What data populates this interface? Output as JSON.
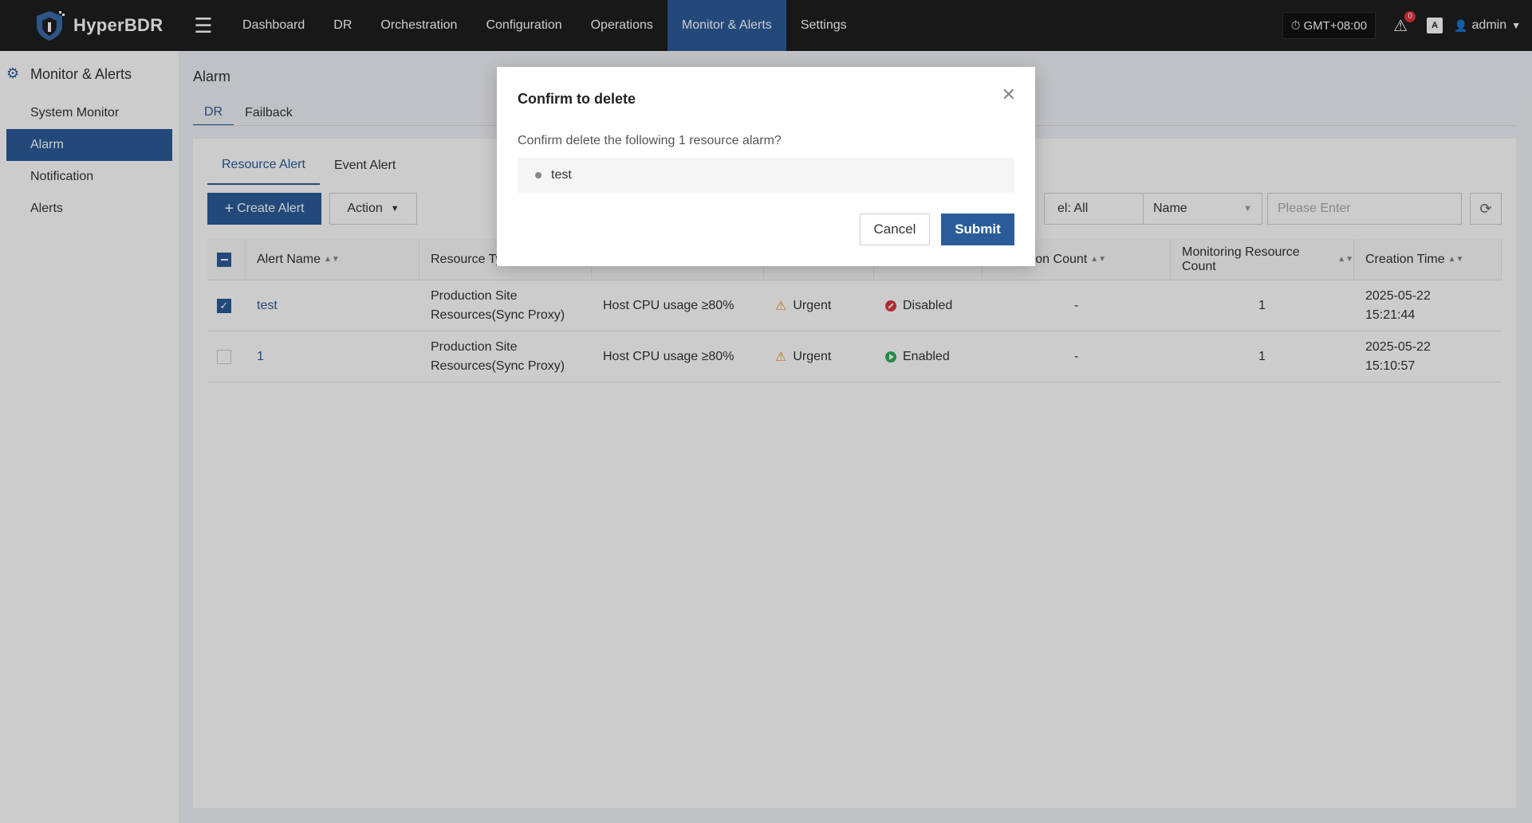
{
  "app": {
    "name": "HyperBDR"
  },
  "nav": {
    "items": [
      "Dashboard",
      "DR",
      "Orchestration",
      "Configuration",
      "Operations",
      "Monitor & Alerts",
      "Settings"
    ],
    "active": "Monitor & Alerts"
  },
  "topbar": {
    "timezone": "GMT+08:00",
    "notification_count": "0",
    "lang_icon": "A",
    "user": "admin"
  },
  "sidebar": {
    "title": "Monitor & Alerts",
    "items": [
      {
        "label": "System Monitor"
      },
      {
        "label": "Alarm"
      },
      {
        "label": "Notification"
      },
      {
        "label": "Alerts"
      }
    ],
    "active": "Alarm"
  },
  "page": {
    "title": "Alarm",
    "tabs": [
      "DR",
      "Failback"
    ],
    "subtabs": [
      "Resource Alert",
      "Event Alert"
    ]
  },
  "toolbar": {
    "create_label": "Create Alert",
    "action_label": "Action",
    "level_filter": "el: All",
    "field_select": "Name",
    "search_placeholder": "Please Enter"
  },
  "table": {
    "columns": [
      "Alert Name",
      "Resource Typ",
      "",
      "",
      "",
      "tion Count",
      "Monitoring Resource Count",
      "Creation Time"
    ],
    "rows": [
      {
        "name": "test",
        "type_line1": "Production Site",
        "type_line2": "Resources(Sync Proxy)",
        "condition": "Host CPU usage ≥80%",
        "level": "Urgent",
        "status": "Disabled",
        "notify": "-",
        "count": "1",
        "date": "2025-05-22",
        "time": "15:21:44"
      },
      {
        "name": "1",
        "type_line1": "Production Site",
        "type_line2": "Resources(Sync Proxy)",
        "condition": "Host CPU usage ≥80%",
        "level": "Urgent",
        "status": "Enabled",
        "notify": "-",
        "count": "1",
        "date": "2025-05-22",
        "time": "15:10:57"
      }
    ]
  },
  "modal": {
    "title": "Confirm to delete",
    "message": "Confirm delete the following 1 resource alarm?",
    "items": [
      "test"
    ],
    "cancel_label": "Cancel",
    "submit_label": "Submit"
  },
  "colors": {
    "primary": "#2b5c99",
    "topbar": "#1f1f1f",
    "warning": "#e8962e",
    "danger": "#d9363e",
    "success": "#2eae5c"
  }
}
